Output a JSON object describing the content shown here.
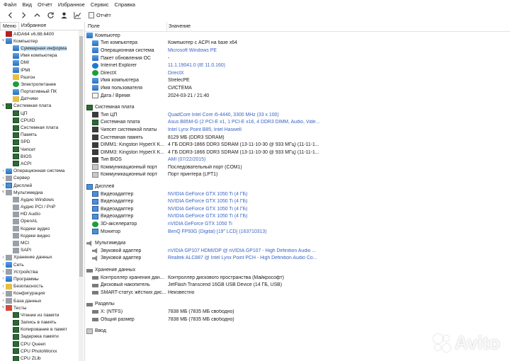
{
  "menubar": [
    "Файл",
    "Вид",
    "Отчёт",
    "Избранное",
    "Сервис",
    "Справка"
  ],
  "toolbar": {
    "icons": [
      "back-icon",
      "forward-icon",
      "up-icon",
      "refresh-icon",
      "user-icon",
      "chart-icon"
    ],
    "report_label": "Отчёт"
  },
  "left_tabs": [
    "Меню",
    "Избранное"
  ],
  "tree": [
    {
      "label": "AIDA64 v6.88.6400",
      "level": 0,
      "exp": "",
      "icon": "aida"
    },
    {
      "label": "Компьютер",
      "level": 0,
      "exp": "v",
      "icon": "blue"
    },
    {
      "label": "Суммарная информа",
      "level": 1,
      "exp": "",
      "icon": "blue",
      "selected": true
    },
    {
      "label": "Имя компьютера",
      "level": 1,
      "exp": "",
      "icon": "blue"
    },
    {
      "label": "DMI",
      "level": 1,
      "exp": "",
      "icon": "blue"
    },
    {
      "label": "IPMI",
      "level": 1,
      "exp": "",
      "icon": "blue"
    },
    {
      "label": "Разгон",
      "level": 1,
      "exp": "",
      "icon": "yellow"
    },
    {
      "label": "Электропитание",
      "level": 1,
      "exp": "",
      "icon": "green"
    },
    {
      "label": "Портативный ПК",
      "level": 1,
      "exp": "",
      "icon": "blue"
    },
    {
      "label": "Датчики",
      "level": 1,
      "exp": "",
      "icon": "yellow"
    },
    {
      "label": "Системная плата",
      "level": 0,
      "exp": "v",
      "icon": "board"
    },
    {
      "label": "ЦП",
      "level": 1,
      "exp": "",
      "icon": "board"
    },
    {
      "label": "CPUID",
      "level": 1,
      "exp": "",
      "icon": "board"
    },
    {
      "label": "Системная плата",
      "level": 1,
      "exp": "",
      "icon": "board"
    },
    {
      "label": "Память",
      "level": 1,
      "exp": "",
      "icon": "board"
    },
    {
      "label": "SPD",
      "level": 1,
      "exp": "",
      "icon": "board"
    },
    {
      "label": "Чипсет",
      "level": 1,
      "exp": "",
      "icon": "board"
    },
    {
      "label": "BIOS",
      "level": 1,
      "exp": "",
      "icon": "board"
    },
    {
      "label": "ACPI",
      "level": 1,
      "exp": "",
      "icon": "board"
    },
    {
      "label": "Операционная система",
      "level": 0,
      "exp": ">",
      "icon": "blue"
    },
    {
      "label": "Сервер",
      "level": 0,
      "exp": ">",
      "icon": "gray"
    },
    {
      "label": "Дисплей",
      "level": 0,
      "exp": ">",
      "icon": "mon"
    },
    {
      "label": "Мультимедиа",
      "level": 0,
      "exp": "v",
      "icon": "gray"
    },
    {
      "label": "Аудио Windows",
      "level": 1,
      "exp": "",
      "icon": "gray"
    },
    {
      "label": "Аудио PCI / PnP",
      "level": 1,
      "exp": "",
      "icon": "gray"
    },
    {
      "label": "HD Audio",
      "level": 1,
      "exp": "",
      "icon": "gray"
    },
    {
      "label": "OpenAL",
      "level": 1,
      "exp": "",
      "icon": "gray"
    },
    {
      "label": "Кодеки аудио",
      "level": 1,
      "exp": "",
      "icon": "gray"
    },
    {
      "label": "Кодеки видео",
      "level": 1,
      "exp": "",
      "icon": "gray"
    },
    {
      "label": "MCI",
      "level": 1,
      "exp": "",
      "icon": "gray"
    },
    {
      "label": "SAPI",
      "level": 1,
      "exp": "",
      "icon": "gray"
    },
    {
      "label": "Хранение данных",
      "level": 0,
      "exp": ">",
      "icon": "gray"
    },
    {
      "label": "Сеть",
      "level": 0,
      "exp": ">",
      "icon": "blue"
    },
    {
      "label": "Устройства",
      "level": 0,
      "exp": ">",
      "icon": "gray"
    },
    {
      "label": "Программы",
      "level": 0,
      "exp": ">",
      "icon": "blue"
    },
    {
      "label": "Безопасность",
      "level": 0,
      "exp": ">",
      "icon": "yellow"
    },
    {
      "label": "Конфигурация",
      "level": 0,
      "exp": ">",
      "icon": "gray"
    },
    {
      "label": "База данных",
      "level": 0,
      "exp": ">",
      "icon": "gray"
    },
    {
      "label": "Тесты",
      "level": 0,
      "exp": "v",
      "icon": "red"
    },
    {
      "label": "Чтение из памяти",
      "level": 1,
      "exp": "",
      "icon": "board"
    },
    {
      "label": "Запись в память",
      "level": 1,
      "exp": "",
      "icon": "board"
    },
    {
      "label": "Копирование в памят",
      "level": 1,
      "exp": "",
      "icon": "board"
    },
    {
      "label": "Задержка памяти",
      "level": 1,
      "exp": "",
      "icon": "board"
    },
    {
      "label": "CPU Queen",
      "level": 1,
      "exp": "",
      "icon": "board"
    },
    {
      "label": "CPU PhotoWorxx",
      "level": 1,
      "exp": "",
      "icon": "board"
    },
    {
      "label": "CPU ZLib",
      "level": 1,
      "exp": "",
      "icon": "board"
    }
  ],
  "columns": {
    "field": "Поле",
    "value": "Значение"
  },
  "rows": [
    {
      "type": "section",
      "field": "Компьютер",
      "icon": "blue"
    },
    {
      "field": "Тип компьютера",
      "value": "Компьютер с ACPI на базе x64",
      "icon": "blue"
    },
    {
      "field": "Операционная система",
      "value": "Microsoft Windows PE",
      "icon": "blue",
      "link": true
    },
    {
      "field": "Пакет обновления ОС",
      "value": "-",
      "icon": "blue"
    },
    {
      "field": "Internet Explorer",
      "value": "11.1.19041.0 (IE 11.0.160)",
      "icon": "ie",
      "link": true
    },
    {
      "field": "DirectX",
      "value": "DirectX",
      "icon": "green",
      "link": true
    },
    {
      "field": "Имя компьютера",
      "value": "StrelecPE",
      "icon": "blue"
    },
    {
      "field": "Имя пользователя",
      "value": "СИСТЕМА",
      "icon": "blue"
    },
    {
      "field": "Дата / Время",
      "value": "2024-03-21 / 21:40",
      "icon": "cal"
    },
    {
      "type": "blank"
    },
    {
      "type": "section",
      "field": "Системная плата",
      "icon": "board"
    },
    {
      "field": "Тип ЦП",
      "value": "QuadCore Intel Core i5-4440, 3300 MHz (33 x 100)",
      "icon": "chip",
      "link": true
    },
    {
      "field": "Системная плата",
      "value": "Asus B85M-G  (2 PCI-E x1, 1 PCI-E x16, 4 DDR3 DIMM, Audio, Vide...",
      "icon": "board",
      "link": true
    },
    {
      "field": "Чипсет системной платы",
      "value": "Intel Lynx Point B85, Intel Haswell",
      "icon": "chip",
      "link": true
    },
    {
      "field": "Системная память",
      "value": "8129 МБ  (DDR3 SDRAM)",
      "icon": "chip"
    },
    {
      "field": "DIMM1: Kingston HyperX K...",
      "value": "4 ГБ DDR3-1866 DDR3 SDRAM  (13-11-10-30 @ 933 МГц)  (11-11-1...",
      "icon": "chip"
    },
    {
      "field": "DIMM3: Kingston HyperX K...",
      "value": "4 ГБ DDR3-1866 DDR3 SDRAM  (13-11-10-30 @ 933 МГц)  (11-11-1...",
      "icon": "chip"
    },
    {
      "field": "Тип BIOS",
      "value": "AMI (07/22/2015)",
      "icon": "chip",
      "link": true
    },
    {
      "field": "Коммуникационный порт",
      "value": "Последовательный порт (COM1)",
      "icon": "gen"
    },
    {
      "field": "Коммуникационный порт",
      "value": "Порт принтера (LPT1)",
      "icon": "gen"
    },
    {
      "type": "blank"
    },
    {
      "type": "section",
      "field": "Дисплей",
      "icon": "mon"
    },
    {
      "field": "Видеоадаптер",
      "value": "NVIDIA GeForce GTX 1050 Ti  (4 ГБ)",
      "icon": "mon",
      "link": true
    },
    {
      "field": "Видеоадаптер",
      "value": "NVIDIA GeForce GTX 1050 Ti  (4 ГБ)",
      "icon": "mon",
      "link": true
    },
    {
      "field": "Видеоадаптер",
      "value": "NVIDIA GeForce GTX 1050 Ti  (4 ГБ)",
      "icon": "mon",
      "link": true
    },
    {
      "field": "Видеоадаптер",
      "value": "NVIDIA GeForce GTX 1050 Ti  (4 ГБ)",
      "icon": "mon",
      "link": true
    },
    {
      "field": "3D-акселератор",
      "value": "nVIDIA GeForce GTX 1050 Ti",
      "icon": "green",
      "link": true
    },
    {
      "field": "Монитор",
      "value": "BenQ FP93G (Digital)  [19\" LCD]  (163710313)",
      "icon": "mon",
      "link": true
    },
    {
      "type": "blank"
    },
    {
      "type": "section",
      "field": "Мультимедиа",
      "icon": "spk"
    },
    {
      "field": "Звуковой адаптер",
      "value": "nVIDIA GP107 HDMI/DP @ nVIDIA GP107 - High Definition Audio ...",
      "icon": "spk",
      "link": true
    },
    {
      "field": "Звуковой адаптер",
      "value": "Realtek ALC887 @ Intel Lynx Point PCH - High Definition Audio Co...",
      "icon": "spk",
      "link": true
    },
    {
      "type": "blank"
    },
    {
      "type": "section",
      "field": "Хранение данных",
      "icon": "disk"
    },
    {
      "field": "Контроллер хранения дан...",
      "value": "Контроллер дискового пространства (Майкрософт)",
      "icon": "disk"
    },
    {
      "field": "Дисковый накопитель",
      "value": "JetFlash Transcend 16GB USB Device  (14 ГБ, USB)",
      "icon": "disk"
    },
    {
      "field": "SMART-статус жёстких дис...",
      "value": "Неизвестно",
      "icon": "disk"
    },
    {
      "type": "blank"
    },
    {
      "type": "section",
      "field": "Разделы",
      "icon": "disk"
    },
    {
      "field": "X: (NTFS)",
      "value": "7838 МБ (7835 МБ свободно)",
      "icon": "disk"
    },
    {
      "field": "Общий размер",
      "value": "7838 МБ (7835 МБ свободно)",
      "icon": "disk"
    },
    {
      "type": "blank"
    },
    {
      "type": "section",
      "field": "Ввод",
      "icon": "gen"
    }
  ],
  "watermark": "Avito"
}
